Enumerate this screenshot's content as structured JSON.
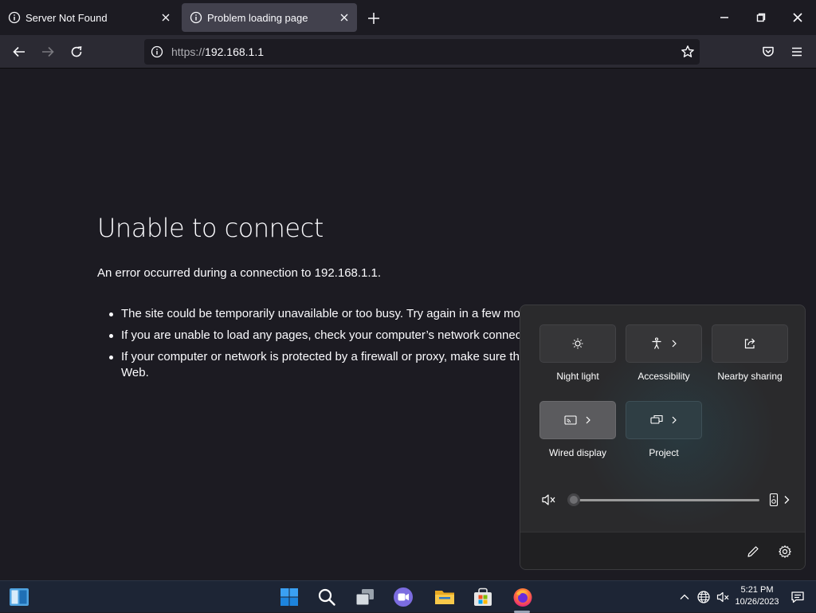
{
  "browser": {
    "tabs": [
      {
        "title": "Server Not Found",
        "active": false
      },
      {
        "title": "Problem loading page",
        "active": true
      }
    ],
    "url": {
      "scheme": "https://",
      "host": "192.168.1.1"
    }
  },
  "error_page": {
    "title": "Unable to connect",
    "description": "An error occurred during a connection to 192.168.1.1.",
    "bullets": [
      "The site could be temporarily unavailable or too busy. Try again in a few mo",
      "If you are unable to load any pages, check your computer’s network connect",
      "If your computer or network is protected by a firewall or proxy, make sure th"
    ],
    "bullet3_continuation": "Web."
  },
  "quick_settings": {
    "tiles": [
      {
        "label": "Night light",
        "icon": "brightness-icon",
        "state": "off"
      },
      {
        "label": "Accessibility",
        "icon": "accessibility-icon",
        "state": "off"
      },
      {
        "label": "Nearby sharing",
        "icon": "share-icon",
        "state": "off"
      },
      {
        "label": "Wired display",
        "icon": "cast-icon",
        "state": "on"
      },
      {
        "label": "Project",
        "icon": "project-icon",
        "state": "off"
      }
    ],
    "volume": {
      "muted": true,
      "level": 0
    }
  },
  "taskbar": {
    "apps": [
      "widgets",
      "start",
      "search",
      "task-view",
      "teams-chat",
      "file-explorer",
      "microsoft-store",
      "firefox"
    ],
    "clock": {
      "time": "5:21 PM",
      "date": "10/26/2023"
    }
  },
  "colors": {
    "page_bg": "#1c1b22",
    "toolbar_bg": "#2b2a33",
    "taskbar_bg": "#1d2535",
    "flyout_bg": "#2a2a2c"
  }
}
